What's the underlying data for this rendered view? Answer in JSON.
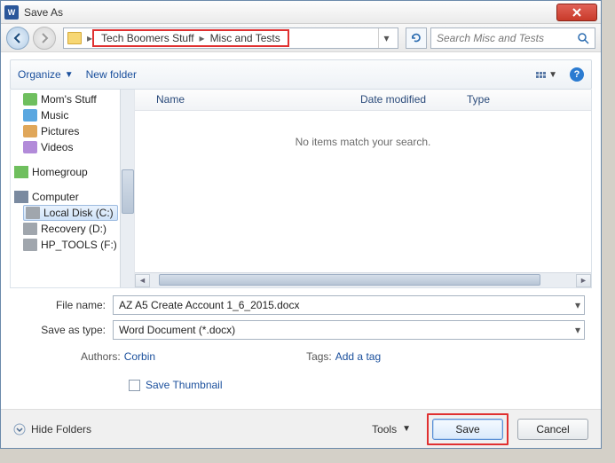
{
  "window": {
    "title": "Save As"
  },
  "nav": {
    "breadcrumb": [
      "Tech Boomers Stuff",
      "Misc and Tests"
    ],
    "search_placeholder": "Search Misc and Tests"
  },
  "toolbar": {
    "organize": "Organize",
    "new_folder": "New folder"
  },
  "tree": {
    "items": [
      {
        "label": "Mom's Stuff",
        "icon": "ic-docs"
      },
      {
        "label": "Music",
        "icon": "ic-music"
      },
      {
        "label": "Pictures",
        "icon": "ic-pics"
      },
      {
        "label": "Videos",
        "icon": "ic-vids"
      }
    ],
    "groups": [
      {
        "label": "Homegroup",
        "icon": "ic-home"
      },
      {
        "label": "Computer",
        "icon": "ic-comp"
      }
    ],
    "drives": [
      {
        "label": "Local Disk (C:)"
      },
      {
        "label": "Recovery (D:)"
      },
      {
        "label": "HP_TOOLS (F:)"
      }
    ]
  },
  "columns": {
    "name": "Name",
    "date": "Date modified",
    "type": "Type"
  },
  "empty_msg": "No items match your search.",
  "fields": {
    "filename_label": "File name:",
    "filename_value": "AZ A5 Create Account 1_6_2015.docx",
    "saveas_label": "Save as type:",
    "saveas_value": "Word Document (*.docx)",
    "authors_label": "Authors:",
    "authors_value": "Corbin",
    "tags_label": "Tags:",
    "tags_value": "Add a tag",
    "save_thumb": "Save Thumbnail"
  },
  "footer": {
    "hide": "Hide Folders",
    "tools": "Tools",
    "save": "Save",
    "cancel": "Cancel"
  }
}
